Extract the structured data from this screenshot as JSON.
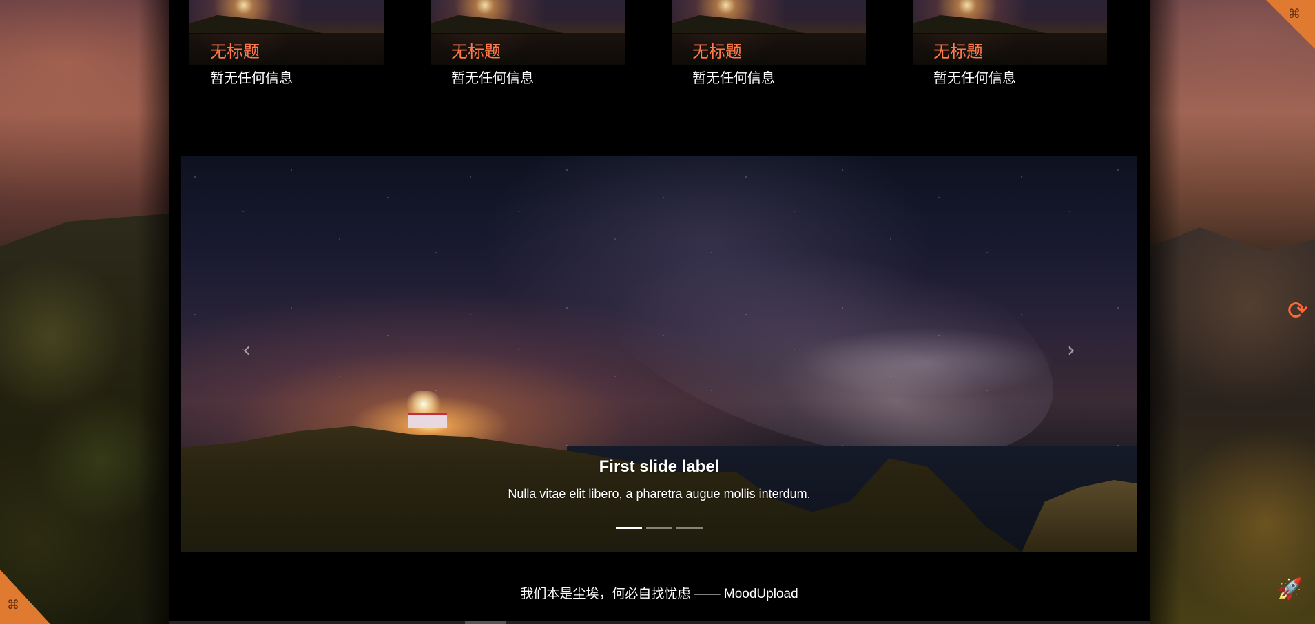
{
  "cards": [
    {
      "title": "无标题",
      "description": "暂无任何信息"
    },
    {
      "title": "无标题",
      "description": "暂无任何信息"
    },
    {
      "title": "无标题",
      "description": "暂无任何信息"
    },
    {
      "title": "无标题",
      "description": "暂无任何信息"
    }
  ],
  "carousel": {
    "slide_title": "First slide label",
    "slide_text": "Nulla vitae elit libero, a pharetra augue mollis interdum.",
    "prev_icon": "chevron-left-icon",
    "next_icon": "chevron-right-icon",
    "prev_glyph": "‹",
    "next_glyph": "›",
    "indicator_count": 3,
    "active_indicator": 1
  },
  "footer": {
    "text": "我们本是尘埃，何必自找忧虑 —— MoodUpload"
  },
  "side_controls": {
    "refresh_icon": "refresh-icon",
    "refresh_glyph": "⟳",
    "rocket_icon": "rocket-icon",
    "rocket_glyph": "🚀",
    "corner_icon": "grid-icon",
    "corner_glyph": "⌘"
  },
  "colors": {
    "accent": "#ff7a4a",
    "corner": "#e07a30",
    "background": "#000000"
  }
}
